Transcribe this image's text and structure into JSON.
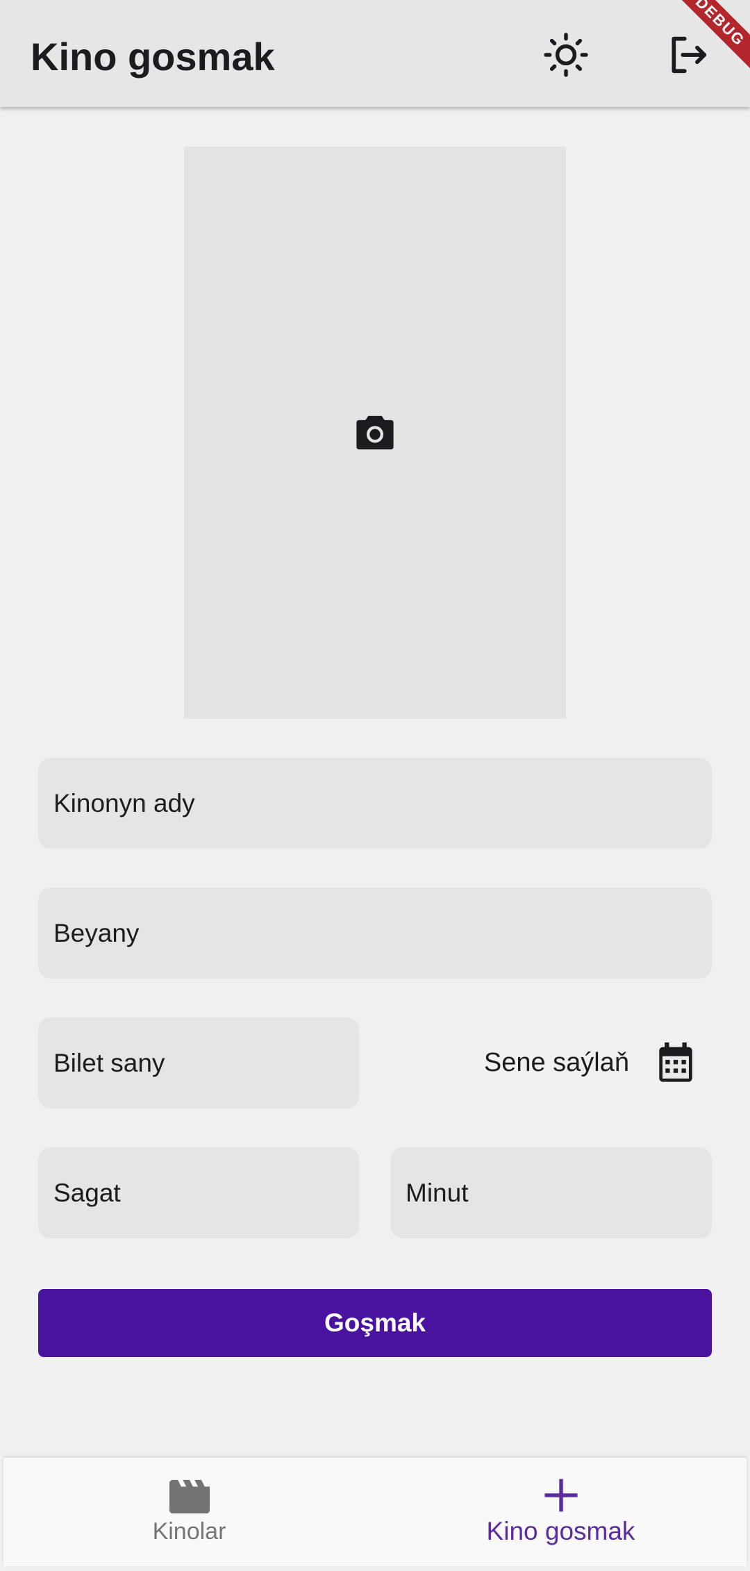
{
  "app_bar": {
    "title": "Kino gosmak",
    "theme_icon": "sun-icon",
    "logout_icon": "logout-icon",
    "debug_ribbon": "DEBUG"
  },
  "image_picker": {
    "icon": "camera-icon"
  },
  "form": {
    "name_placeholder": "Kinonyn ady",
    "description_placeholder": "Beyany",
    "ticket_count_placeholder": "Bilet sany",
    "date_label": "Sene saýlaň",
    "date_icon": "calendar-icon",
    "hour_placeholder": "Sagat",
    "minute_placeholder": "Minut",
    "submit_label": "Goşmak"
  },
  "bottom_nav": {
    "items": [
      {
        "label": "Kinolar",
        "icon": "movie-clapper-icon",
        "active": false
      },
      {
        "label": "Kino gosmak",
        "icon": "plus-icon",
        "active": true
      }
    ]
  },
  "colors": {
    "primary": "#4a139f",
    "active_nav": "#5b2ca0",
    "inactive_nav": "#757575",
    "app_bar_bg": "#e6e6e6",
    "field_bg": "#e5e5e5",
    "page_bg": "#f0f0f0"
  }
}
